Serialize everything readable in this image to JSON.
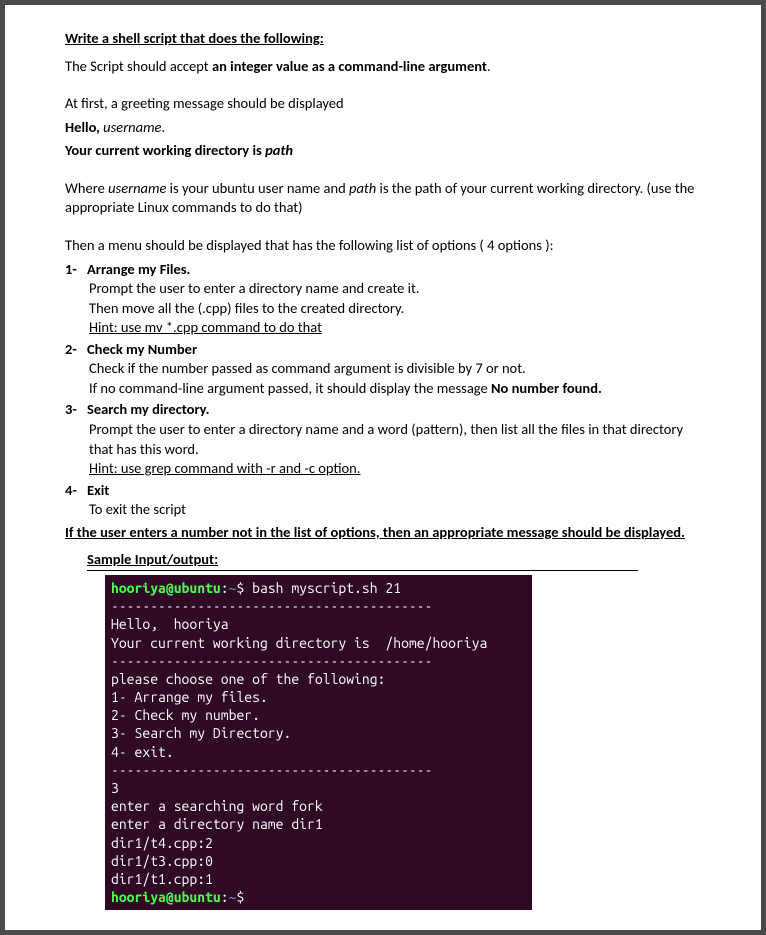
{
  "doc": {
    "title": "Write a shell script that does the following:",
    "intro_pre": "The Script should accept ",
    "intro_bold": "an integer value as a command-line argument",
    "intro_post": ".",
    "greeting_intro": "At first, a greeting message should be displayed",
    "greeting_hello_bold": "Hello, ",
    "greeting_hello_italic": "username",
    "greeting_hello_post": ".",
    "greeting_cwd_bold": "Your current working directory is ",
    "greeting_cwd_italic": "path",
    "where_pre": "Where ",
    "where_user": "username",
    "where_mid": " is your ubuntu user name and ",
    "where_path": "path",
    "where_post": " is the path of your current working directory. (use the appropriate Linux commands to do that)",
    "menu_intro": "Then a menu should be displayed that has the following list of options ( 4 options ):",
    "options": [
      {
        "num": "1-",
        "title": "Arrange my Files.",
        "lines": [
          "Prompt the user to enter a directory name and create it.",
          "Then move all the (.cpp) files to the created directory."
        ],
        "hint": "Hint: use mv *.cpp  command to do that"
      },
      {
        "num": "2-",
        "title": "Check my Number",
        "lines": [
          "Check if the number passed as command argument is divisible by 7 or not."
        ],
        "line_with_bold_pre": "If no command-line argument passed, it should display the message ",
        "line_with_bold_bold": "No number found."
      },
      {
        "num": "3-",
        "title": "Search my directory.",
        "lines": [
          "Prompt the user to enter a directory name and a word (pattern), then list all the files in that directory that has this word."
        ],
        "hint": "Hint: use grep command with -r and -c option."
      },
      {
        "num": "4-",
        "title": "Exit",
        "lines": [
          "To exit the script"
        ]
      }
    ],
    "bottom_note": "If the user enters a number not in the list of options, then an appropriate message should be displayed.",
    "sample_heading": "Sample Input/output:",
    "terminal": {
      "prompt_user": "hooriya@ubuntu",
      "prompt_sep": ":",
      "prompt_path": "~",
      "prompt_dollar": "$ ",
      "cmd": "bash myscript.sh 21",
      "dashes1": "-----------------------------------------",
      "hello": "Hello,  hooriya",
      "cwd": "Your current working directory is  /home/hooriya",
      "dashes2": "-----------------------------------------",
      "please": "please choose one of the following:",
      "m1": "1- Arrange my files.",
      "m2": "2- Check my number.",
      "m3": "3- Search my Directory.",
      "m4": "4- exit.",
      "dashes3": "-----------------------------------------",
      "input3": "3",
      "enter_word": "enter a searching word fork",
      "enter_dir": "enter a directory name dir1",
      "r1": "dir1/t4.cpp:2",
      "r2": "dir1/t3.cpp:0",
      "r3": "dir1/t1.cpp:1"
    }
  }
}
